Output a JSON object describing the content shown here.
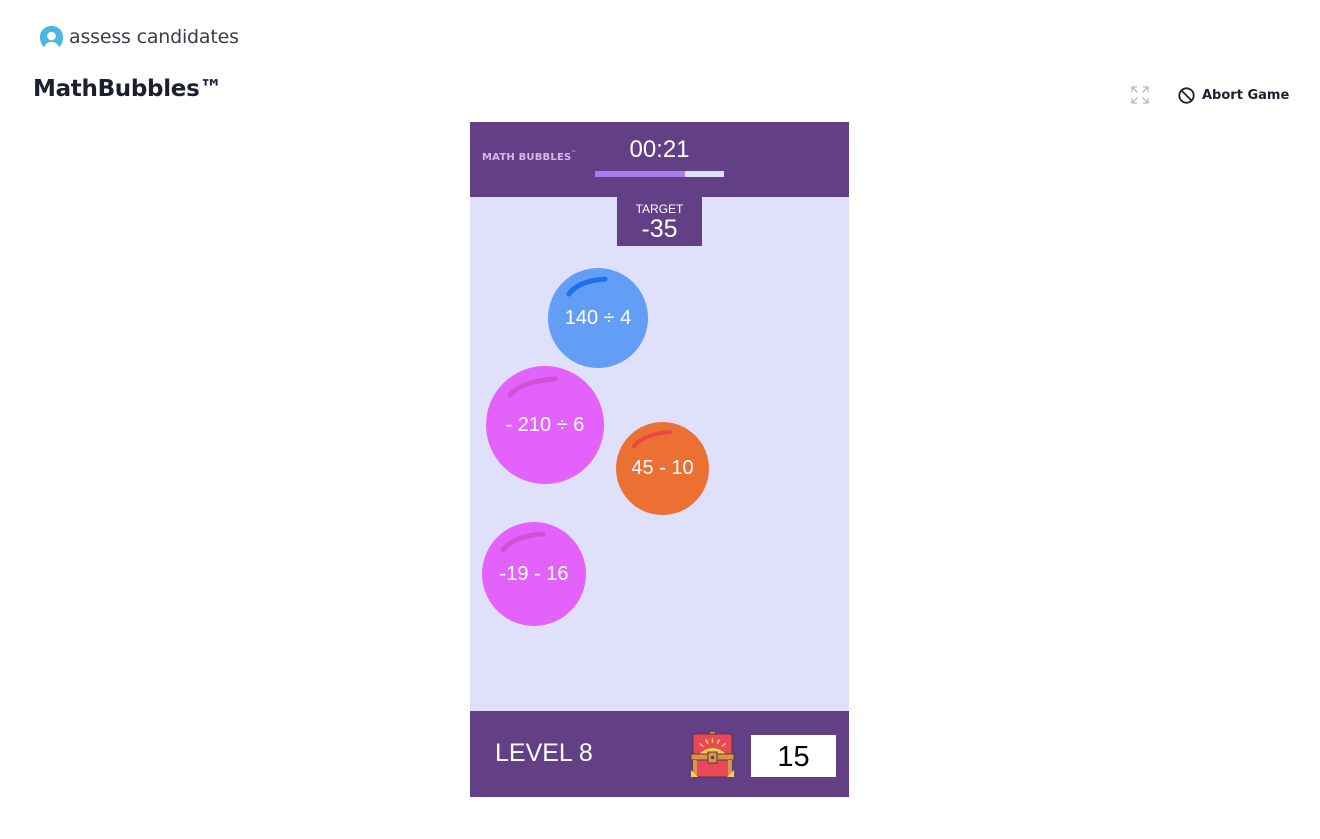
{
  "brand": {
    "name": "assess candidates",
    "logo_icon": "brand-logo-icon",
    "color": "#4ab7e0"
  },
  "page": {
    "title": "MathBubbles™"
  },
  "toolbar": {
    "expand_icon": "expand-icon",
    "abort_label": "Abort Game",
    "abort_icon": "prohibited-icon"
  },
  "game": {
    "logo": "MATH BUBBLES",
    "logo_tm": "™",
    "timer": "00:21",
    "time_remaining_fraction": 0.7,
    "target_label": "TARGET",
    "target_value": "-35",
    "bubbles": [
      {
        "expression": "140 ÷ 4",
        "color": "#629ef6",
        "shine": "#1b6ff0"
      },
      {
        "expression": "- 210 ÷ 6",
        "color": "#e362fb",
        "shine": "#cf52d6"
      },
      {
        "expression": "45 - 10",
        "color": "#ec6f34",
        "shine": "#e9473f"
      },
      {
        "expression": "-19 - 16",
        "color": "#e362fb",
        "shine": "#cf52d6"
      }
    ],
    "level_label": "LEVEL 8",
    "chest_icon": "treasure-chest-icon",
    "score": "15"
  },
  "colors": {
    "header_bg": "#633f86",
    "play_area_bg": "#dfe1fb",
    "timer_fill": "#a77df2"
  }
}
